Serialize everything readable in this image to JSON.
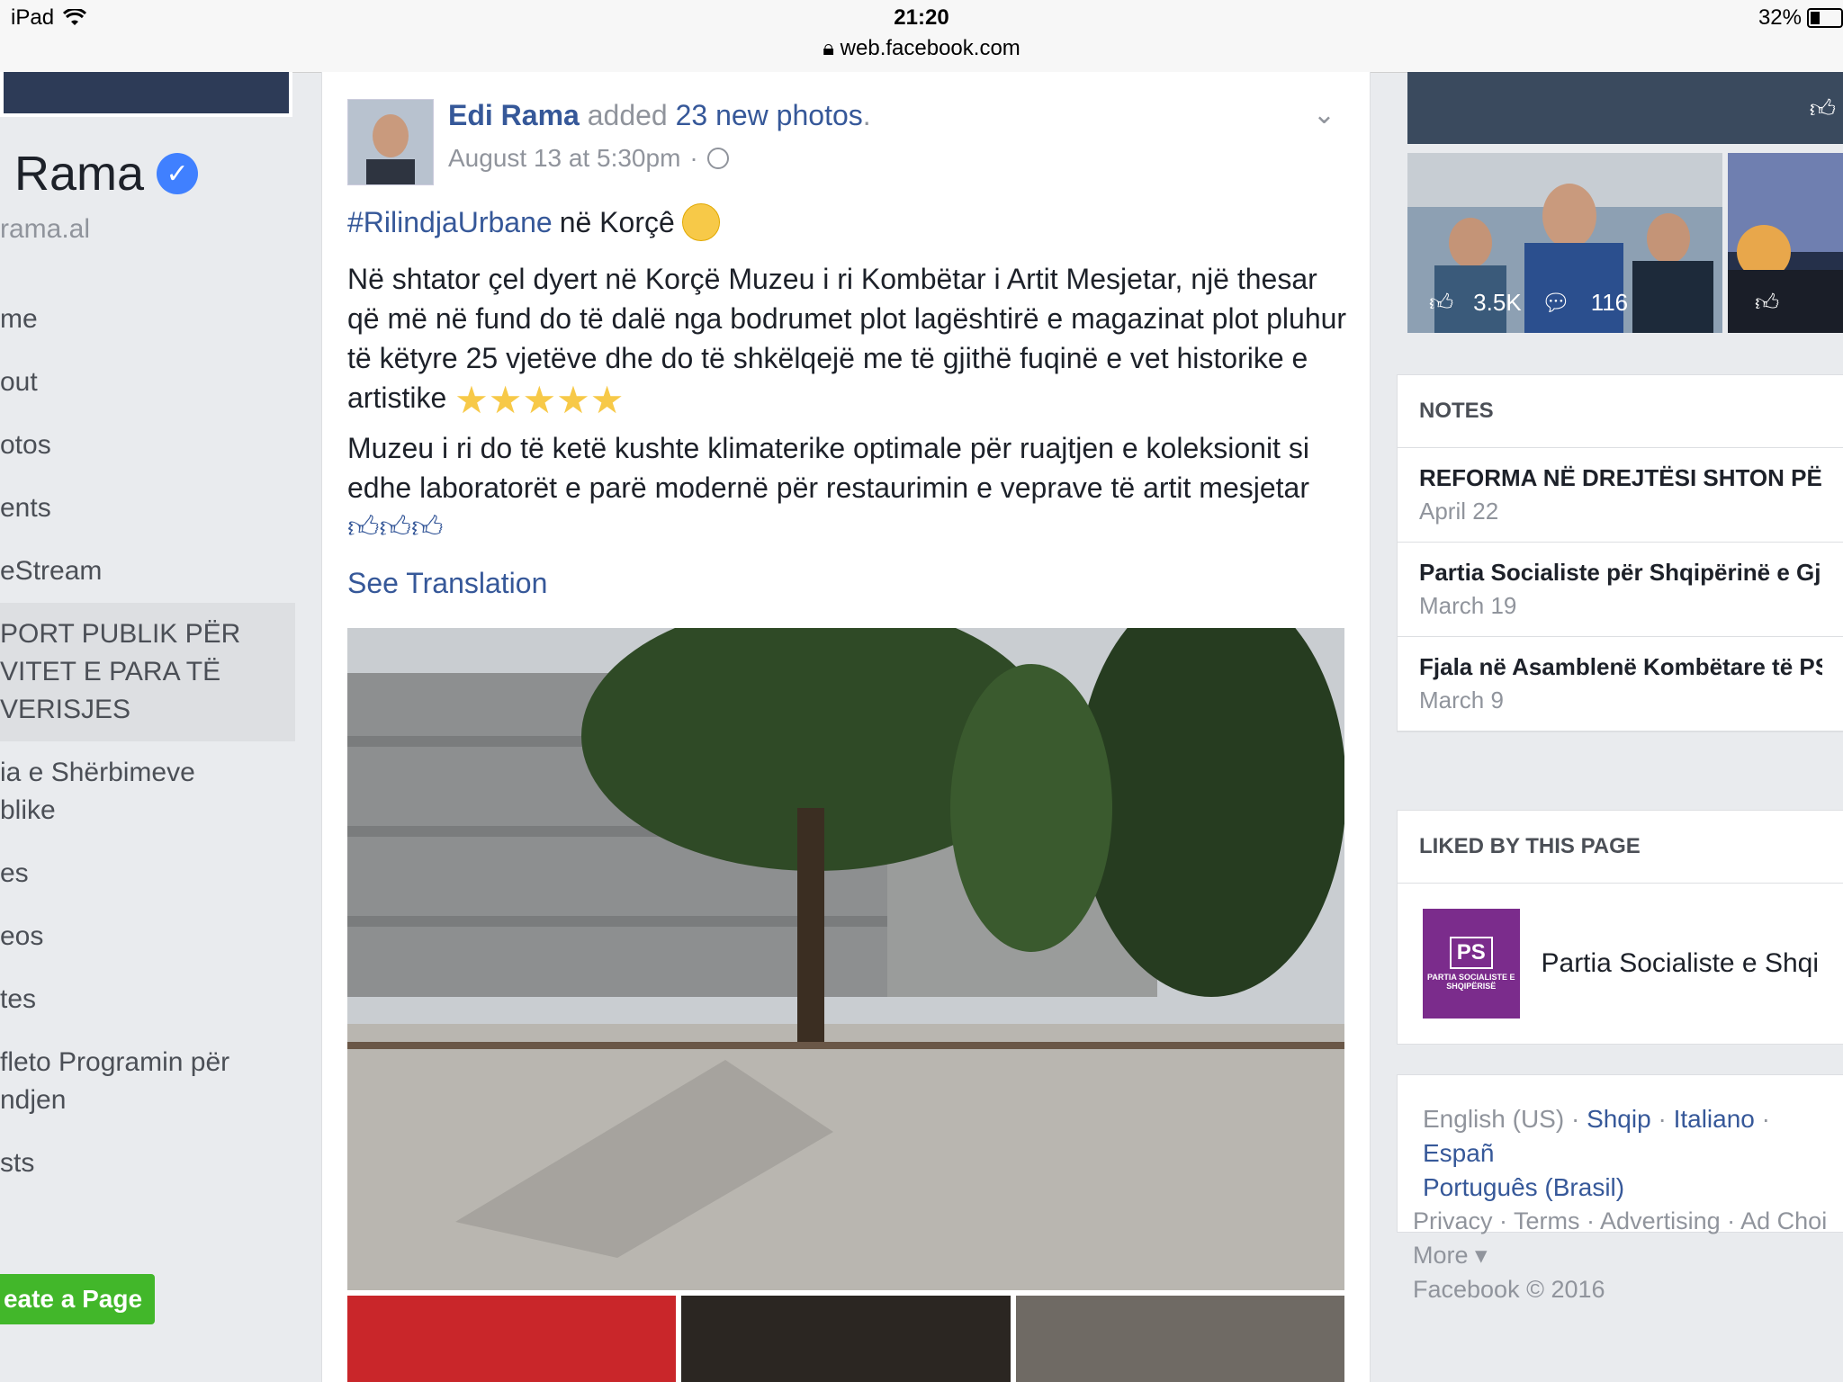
{
  "status_bar": {
    "device": "iPad",
    "time": "21:20",
    "url": "web.facebook.com",
    "battery": "32%",
    "battery_level": 0.32
  },
  "left": {
    "name": "Rama",
    "handle": "rama.al",
    "nav": [
      {
        "label": "me",
        "active": false
      },
      {
        "label": "out",
        "active": false
      },
      {
        "label": "otos",
        "active": false
      },
      {
        "label": "ents",
        "active": false
      },
      {
        "label": "eStream",
        "active": false
      },
      {
        "label": "PORT PUBLIK PËR\nVITET E PARA TË\nVERISJES",
        "active": true
      },
      {
        "label": "ia e Shërbimeve\nblike",
        "active": false
      },
      {
        "label": "es",
        "active": false
      },
      {
        "label": "eos",
        "active": false
      },
      {
        "label": "tes",
        "active": false
      },
      {
        "label": "fleto Programin për\nndjen",
        "active": false
      },
      {
        "label": "sts",
        "active": false
      }
    ],
    "create_button": "eate a Page"
  },
  "post": {
    "author": "Edi Rama",
    "action": "added",
    "photos_link": "23 new photos",
    "period": ".",
    "time": "August 13 at 5:30pm",
    "sep": "·",
    "hashtag": "#RilindjaUrbane",
    "hash_rest": "në Korçê",
    "para1": "Në shtator çel dyert në Korçë Muzeu i ri Kombëtar i Artit Mesjetar, një thesar që më në fund do të dalë nga bodrumet plot lagështirë e magazinat plot pluhur të këtyre 25 vjetëve dhe do të shkëlqejë me të gjithë fuqinë e vet historike e artistike",
    "para2": "Muzeu i ri do të ketë kushte klimaterike optimale për ruajtjen e koleksionit si edhe laboratorët e parë modernë për restaurimin e veprave të artit mesjetar",
    "see_translation": "See Translation"
  },
  "right": {
    "photo_likes": "3.5K",
    "photo_comments": "116",
    "notes_title": "NOTES",
    "notes": [
      {
        "title": "REFORMA NË DREJTËSI SHTON PËR",
        "date": "April 22"
      },
      {
        "title": "Partia Socialiste për Shqipërinë e Gj",
        "date": "March 19"
      },
      {
        "title": "Fjala në Asamblenë Kombëtare të PS",
        "date": "March 9"
      }
    ],
    "liked_title": "LIKED BY THIS PAGE",
    "liked_page": "Partia Socialiste e Shqi",
    "ps_logo_text": "PS",
    "ps_logo_sub": "PARTIA SOCIALISTE E SHQIPËRISË",
    "languages": {
      "current": "English (US)",
      "l1": "Shqip",
      "l2": "Italiano",
      "l3": "Españ",
      "l4": "Português (Brasil)",
      "sep": " · "
    },
    "footer": {
      "privacy": "Privacy",
      "terms": "Terms",
      "advertising": "Advertising",
      "adchoices": "Ad Choi",
      "more": "More",
      "copyright": "Facebook © 2016",
      "sep": " · "
    }
  },
  "colors": {
    "fb_link": "#365899",
    "bg": "#e9ebee",
    "green": "#42b72a",
    "ps_purple": "#7b2c8c"
  }
}
